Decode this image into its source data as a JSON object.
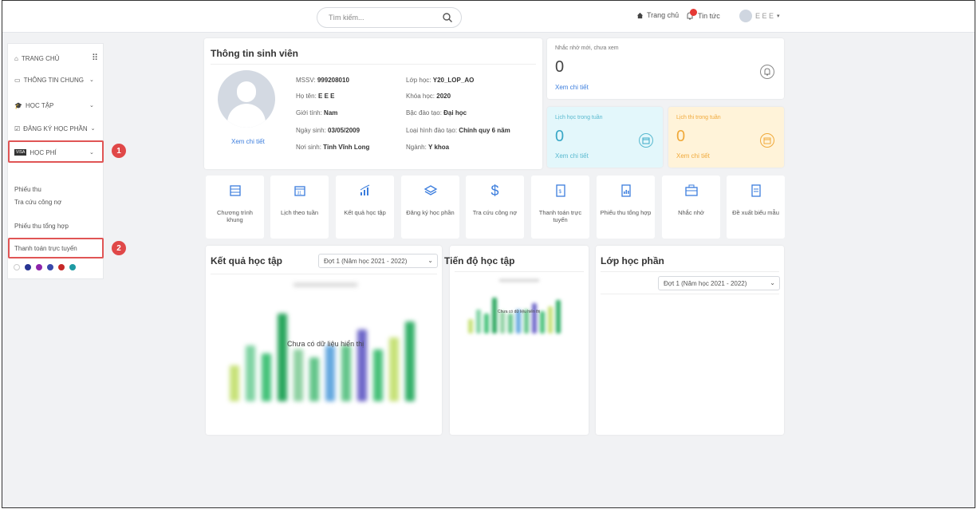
{
  "topbar": {
    "search_placeholder": "Tìm kiếm...",
    "home_label": "Trang chủ",
    "news_label": "Tin tức",
    "user_label": "E E E"
  },
  "sidebar": {
    "home": "TRANG CHỦ",
    "general_info": "THÔNG TIN CHUNG",
    "study": "HỌC TẬP",
    "course_registration": "ĐĂNG KÝ HỌC PHẦN",
    "tuition": "HỌC PHÍ",
    "sub_items": [
      "Phiếu thu",
      "Tra cứu công nợ",
      "Phiếu thu tổng hợp",
      "Thanh toán trực tuyến"
    ],
    "theme_colors": [
      "#ffffff",
      "#283593",
      "#8e24aa",
      "#3949ab",
      "#c62828",
      "#1e9aa3"
    ],
    "annotations": [
      "1",
      "2"
    ]
  },
  "student": {
    "title": "Thông tin sinh viên",
    "view_detail": "Xem chi tiết",
    "mssv_label": "MSSV:",
    "mssv": "999208010",
    "name_label": "Họ tên:",
    "name": "E E E",
    "gender_label": "Giới tính:",
    "gender": "Nam",
    "dob_label": "Ngày sinh:",
    "dob": "03/05/2009",
    "pob_label": "Nơi sinh:",
    "pob": "Tỉnh Vĩnh Long",
    "class_label": "Lớp học:",
    "class": "Y20_LOP_AO",
    "course_label": "Khóa học:",
    "course": "2020",
    "level_label": "Bậc đào tạo:",
    "level": "Đại học",
    "type_label": "Loại hình đào tạo:",
    "type": "Chính quy 6 năm",
    "major_label": "Ngành:",
    "major": "Y khoa"
  },
  "reminders": {
    "title": "Nhắc nhở mới, chưa xem",
    "count": "0",
    "view_detail": "Xem chi tiết"
  },
  "schedule": {
    "title": "Lịch học trong tuần",
    "count": "0",
    "view_detail": "Xem chi tiết"
  },
  "exams": {
    "title": "Lịch thi trong tuần",
    "count": "0",
    "view_detail": "Xem chi tiết"
  },
  "quick_actions": [
    "Chương trình khung",
    "Lịch theo tuần",
    "Kết quả học tập",
    "Đăng ký học phần",
    "Tra cứu công nợ",
    "Thanh toán trực tuyến",
    "Phiếu thu tổng hợp",
    "Nhắc nhở",
    "Đề xuất biểu mẫu"
  ],
  "results": {
    "title": "Kết quả học tập",
    "term": "Đợt 1 (Năm học 2021 - 2022)",
    "no_data": "Chưa có dữ liệu hiển thị"
  },
  "progress": {
    "title": "Tiến độ học tập",
    "no_data": "Chưa có dữ liệu hiển thị"
  },
  "classes": {
    "title": "Lớp học phần",
    "term": "Đợt 1 (Năm học 2021 - 2022)"
  },
  "colors": {
    "accent_blue": "#3b7ddd",
    "schedule_bg": "#e3f7fb",
    "exam_bg": "#fff3d9",
    "exam_accent": "#f0a93a",
    "annotation_red": "#e04848"
  }
}
